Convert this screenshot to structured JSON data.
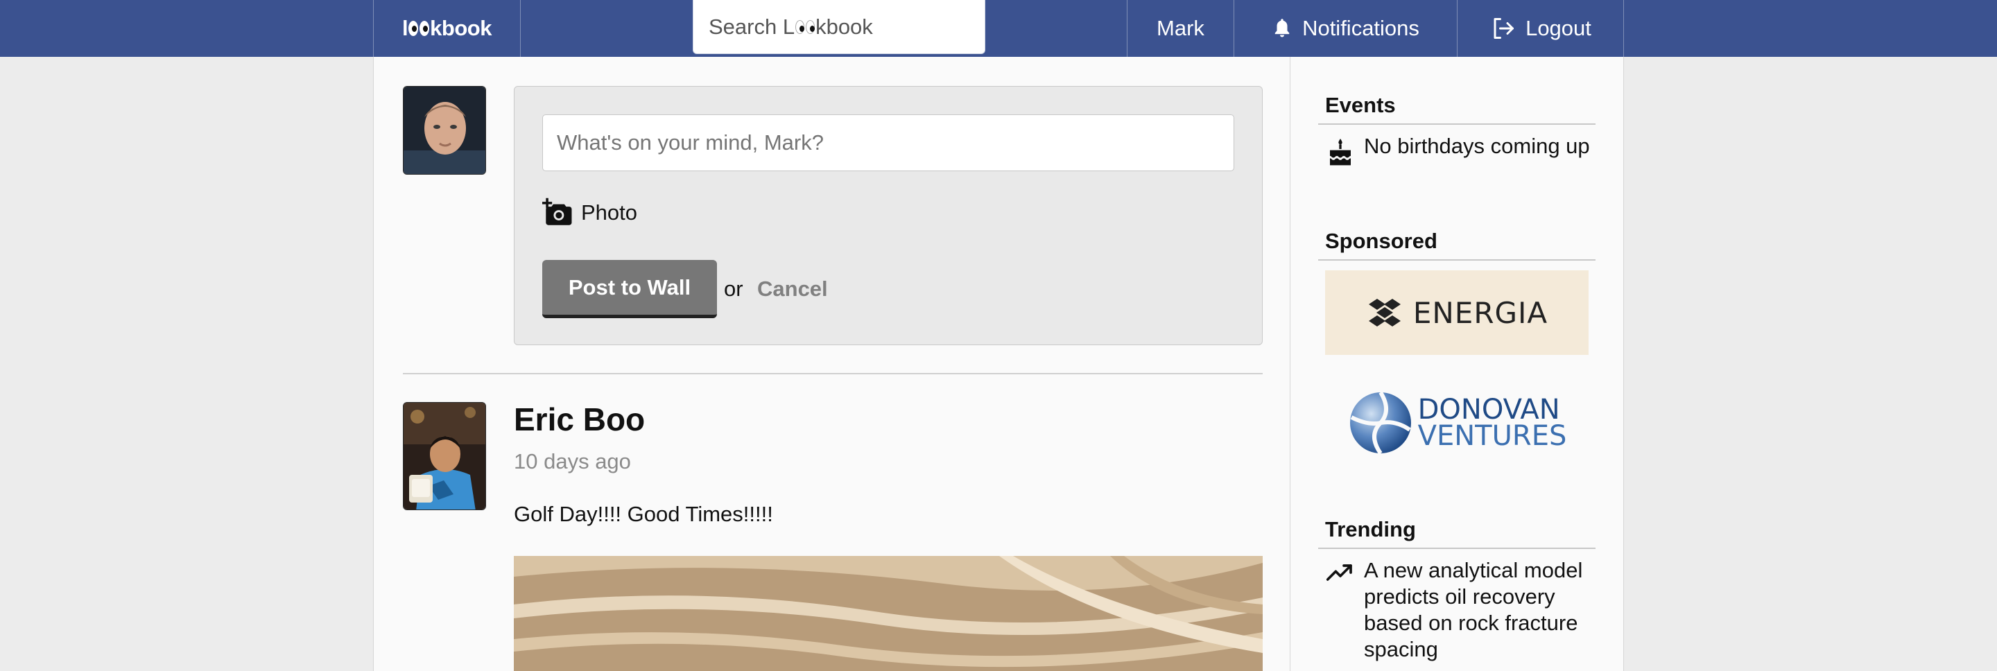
{
  "header": {
    "logo_text": "kbook",
    "search_placeholder_prefix": "Search L",
    "search_placeholder_suffix": "kbook",
    "user_link": "Mark",
    "notifications_label": "Notifications",
    "logout_label": "Logout"
  },
  "composer": {
    "placeholder": "What's on your mind, Mark?",
    "photo_label": "Photo",
    "post_button": "Post to Wall",
    "or_text": "or",
    "cancel_link": "Cancel"
  },
  "post": {
    "author": "Eric Boo",
    "time": "10 days ago",
    "text": "Golf Day!!!! Good Times!!!!!"
  },
  "sidebar": {
    "events_title": "Events",
    "events_text": "No birthdays coming up",
    "sponsored_title": "Sponsored",
    "ad1_name": "ENERGIA",
    "ad2_line1": "DONOVAN",
    "ad2_line2": "VENTURES",
    "trending_title": "Trending",
    "trending_text": "A new analytical model predicts oil recovery based on rock fracture spacing"
  },
  "icons": {
    "bell": "bell-icon",
    "logout": "logout-icon",
    "camera": "camera-add-icon",
    "cake": "birthday-cake-icon",
    "trend": "trending-up-icon"
  },
  "colors": {
    "topbar": "#3b5290",
    "button": "#777777",
    "energia_bg": "#f4ead9",
    "donovan_blue": "#1f4a86"
  }
}
